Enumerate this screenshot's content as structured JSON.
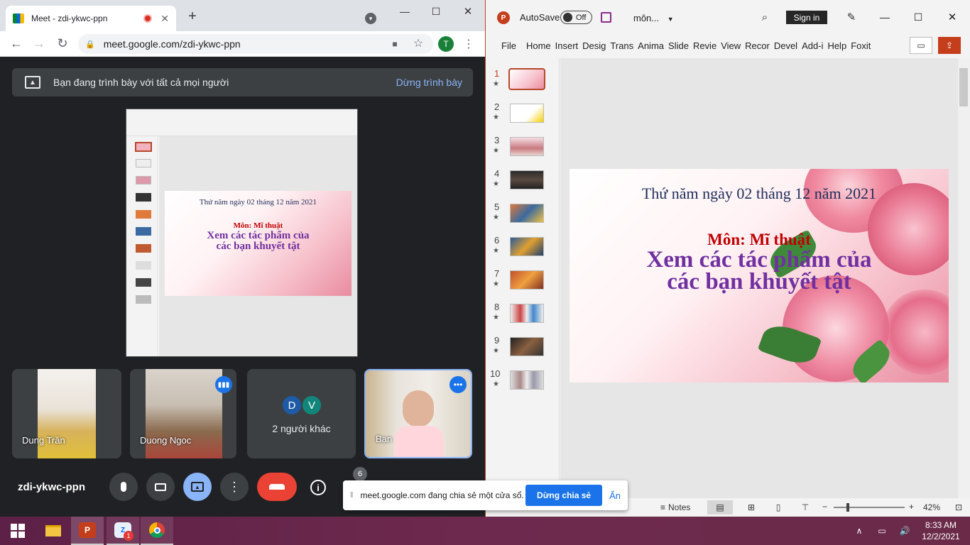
{
  "chrome": {
    "tab_title": "Meet - zdi-ykwc-ppn",
    "url": "meet.google.com/zdi-ykwc-ppn",
    "profile_initial": "T"
  },
  "meet": {
    "banner_text": "Bạn đang trình bày với tất cả mọi người",
    "stop_present_label": "Dừng trình bày",
    "meeting_code": "zdi-ykwc-ppn",
    "participants": [
      {
        "name": "Dung Trần"
      },
      {
        "name": "Duong Ngoc"
      },
      {
        "name": "2 người khác",
        "initials": [
          "D",
          "V"
        ]
      },
      {
        "name": "Bạn"
      }
    ],
    "participant_count": "6",
    "share_popup": {
      "text": "meet.google.com đang chia sẻ một cửa sổ.",
      "stop_label": "Dừng chia sẻ",
      "hide_label": "Ẩn"
    }
  },
  "ppt": {
    "autosave_label": "AutoSave",
    "toggle_label": "Off",
    "filename": "môn...",
    "signin_label": "Sign in",
    "tabs": [
      "File",
      "Home",
      "Insert",
      "Desig",
      "Trans",
      "Anima",
      "Slide",
      "Revie",
      "View",
      "Recor",
      "Devel",
      "Add-i",
      "Help",
      "Foxit"
    ],
    "slide_numbers": [
      "1",
      "2",
      "3",
      "4",
      "5",
      "6",
      "7",
      "8",
      "9",
      "10"
    ],
    "slide": {
      "date": "Thứ năm ngày 02 tháng 12 năm 2021",
      "subject": "Môn: Mĩ thuật",
      "title_line1": "Xem các tác phẩm của",
      "title_line2": "các bạn khuyết tật"
    },
    "status": {
      "notes_label": "Notes",
      "zoom": "42%"
    }
  },
  "taskbar": {
    "time": "8:33 AM",
    "date": "12/2/2021",
    "badge": "1"
  },
  "colors": {
    "meet_bg": "#202124",
    "meet_blue": "#8ab4f8",
    "end_call": "#ea4335",
    "ppt_accent": "#b7472a",
    "slide_date": "#1f2d5a",
    "slide_subject": "#c00000",
    "slide_title": "#7030a0"
  }
}
